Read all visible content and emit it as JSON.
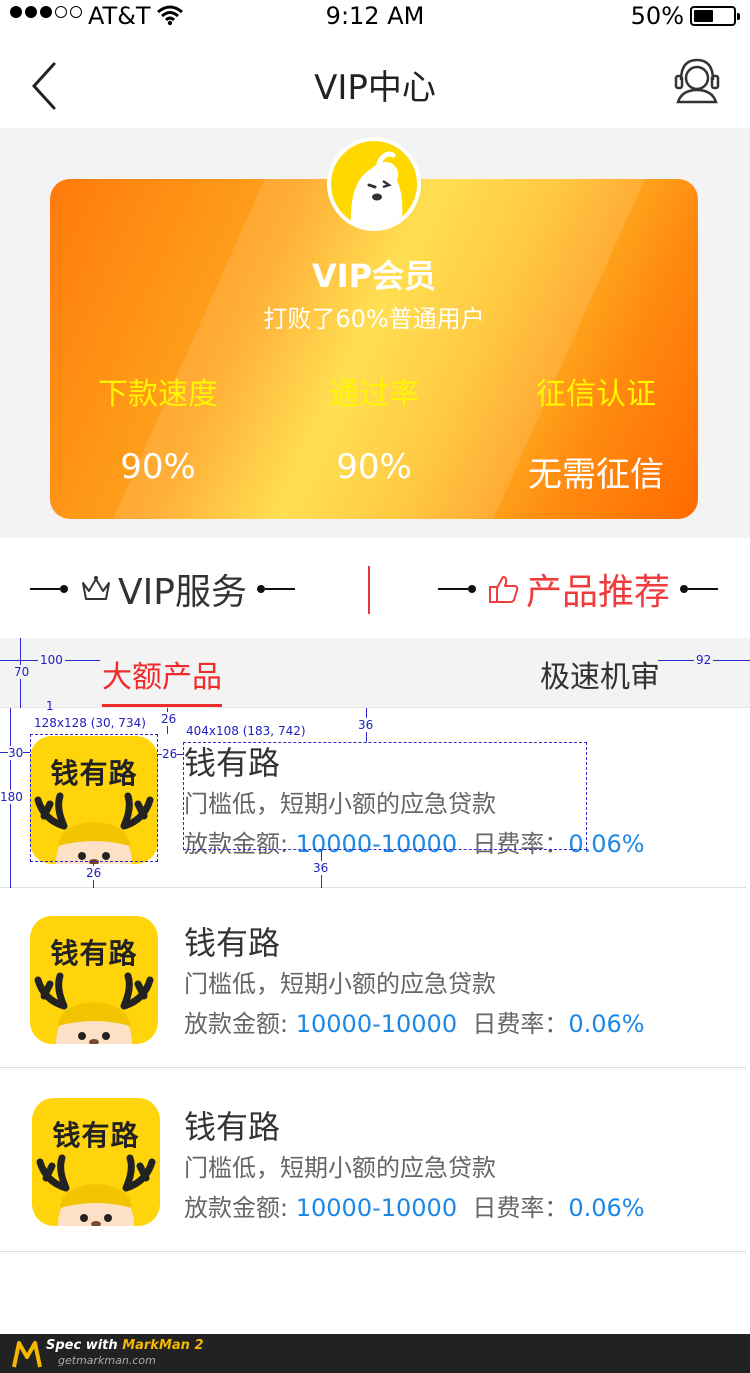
{
  "status": {
    "carrier": "AT&T",
    "time": "9:12 AM",
    "battery": "50%",
    "battery_level": 0.5
  },
  "nav": {
    "title": "VIP中心"
  },
  "vip": {
    "title": "VIP会员",
    "subtitle": "打败了60%普通用户",
    "stats": [
      {
        "label": "下款速度",
        "value": "90%"
      },
      {
        "label": "通过率",
        "value": "90%"
      },
      {
        "label": "征信认证",
        "value": "无需征信"
      }
    ]
  },
  "tabs": {
    "vip": "VIP服务",
    "product": "产品推荐"
  },
  "sub_tabs": {
    "first": "大额产品",
    "second": "极速机审"
  },
  "products": [
    {
      "logo_text": "钱有路",
      "name": "钱有路",
      "desc": "门槛低，短期小额的应急贷款",
      "amount_label": "放款金额:",
      "amount": "10000-10000",
      "rate_label": "日费率：",
      "rate": "0.06%"
    },
    {
      "logo_text": "钱有路",
      "name": "钱有路",
      "desc": "门槛低，短期小额的应急贷款",
      "amount_label": "放款金额:",
      "amount": "10000-10000",
      "rate_label": "日费率：",
      "rate": "0.06%"
    },
    {
      "logo_text": "钱有路",
      "name": "钱有路",
      "desc": "门槛低，短期小额的应急贷款",
      "amount_label": "放款金额:",
      "amount": "10000-10000",
      "rate_label": "日费率：",
      "rate": "0.06%"
    }
  ],
  "annotations": {
    "a100": "100",
    "a92": "92",
    "a70": "70",
    "a1": "1",
    "logo_box": "128x128 (30, 734)",
    "text_box": "404x108 (183, 742)",
    "a26_top": "26",
    "a36_top": "36",
    "a30": "30",
    "a180": "180",
    "a26_right": "26",
    "a26_bottom": "26",
    "a36_bottom": "36"
  },
  "footer": {
    "spec_prefix": "Spec with ",
    "spec_name": "MarkMan 2",
    "site": "getmarkman.com"
  },
  "colors": {
    "accent_red": "#ef2b2b",
    "link_blue": "#1e88e5",
    "stat_yellow": "#fff600"
  }
}
